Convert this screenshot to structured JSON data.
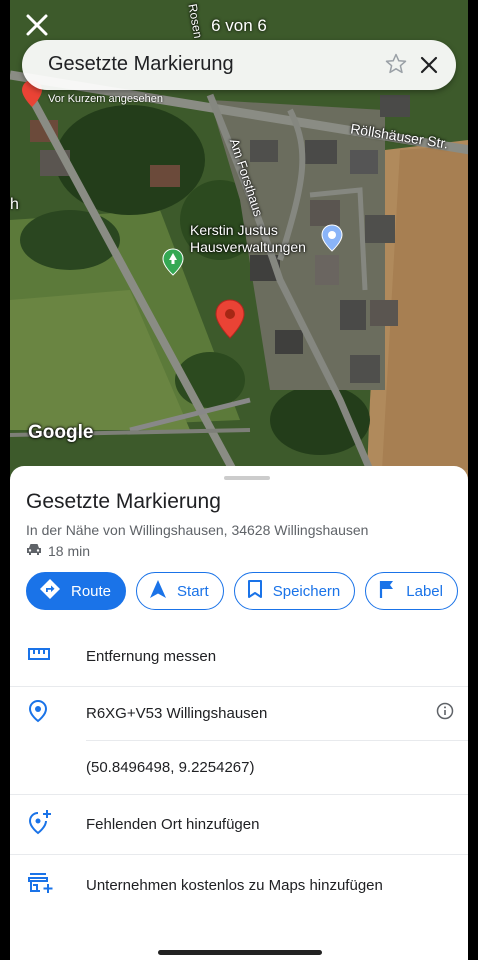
{
  "map": {
    "street_roesllhaeuser": "Röllshäuser Str.",
    "street_forsthaus": "Am Forsthaus",
    "street_rosen": "Rosen",
    "poi": "Kerstin Justus Hausverwaltungen",
    "attribution": "Google",
    "recent_label": "Vor Kurzem angesehen",
    "edge_letter": "h"
  },
  "topbar": {
    "counter": "6 von 6",
    "search_title": "Gesetzte Markierung"
  },
  "sheet": {
    "title": "Gesetzte Markierung",
    "address": "In der Nähe von Willingshausen, 34628 Willingshausen",
    "drive_time": "18 min",
    "buttons": {
      "route": "Route",
      "start": "Start",
      "save": "Speichern",
      "label": "Label"
    },
    "rows": {
      "measure": "Entfernung messen",
      "pluscode": "R6XG+V53 Willingshausen",
      "coordinates": "(50.8496498, 9.2254267)",
      "add_place": "Fehlenden Ort hinzufügen",
      "add_business": "Unternehmen kostenlos zu Maps hinzufügen"
    }
  },
  "colors": {
    "accent": "#1a73e8",
    "pin": "#ea4335",
    "text": "#202124",
    "secondary": "#5f6368"
  }
}
